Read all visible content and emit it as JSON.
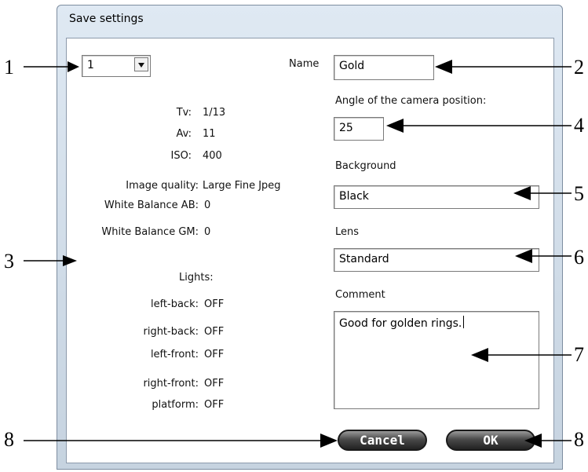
{
  "window": {
    "title": "Save settings"
  },
  "preset": {
    "value": "1"
  },
  "settings": [
    {
      "label": "Tv:",
      "value": "1/13"
    },
    {
      "label": "Av:",
      "value": "11"
    },
    {
      "label": "ISO:",
      "value": "400"
    },
    {
      "label": "Image quality:",
      "value": "Large Fine Jpeg"
    },
    {
      "label": "White Balance AB:",
      "value": "0"
    },
    {
      "label": "White Balance GM:",
      "value": "0"
    }
  ],
  "lights": {
    "title": "Lights:",
    "items": [
      {
        "label": "left-back:",
        "value": "OFF"
      },
      {
        "label": "right-back:",
        "value": "OFF"
      },
      {
        "label": "left-front:",
        "value": "OFF"
      },
      {
        "label": "right-front:",
        "value": "OFF"
      },
      {
        "label": "platform:",
        "value": "OFF"
      }
    ]
  },
  "form": {
    "name_label": "Name",
    "name_value": "Gold",
    "angle_label": "Angle of the camera position:",
    "angle_value": "25",
    "background_label": "Background",
    "background_value": "Black",
    "lens_label": "Lens",
    "lens_value": "Standard",
    "comment_label": "Comment",
    "comment_value": "Good for golden rings."
  },
  "buttons": {
    "cancel": "Cancel",
    "ok": "OK"
  },
  "callouts": [
    "1",
    "2",
    "3",
    "4",
    "5",
    "6",
    "7",
    "8",
    "8"
  ]
}
